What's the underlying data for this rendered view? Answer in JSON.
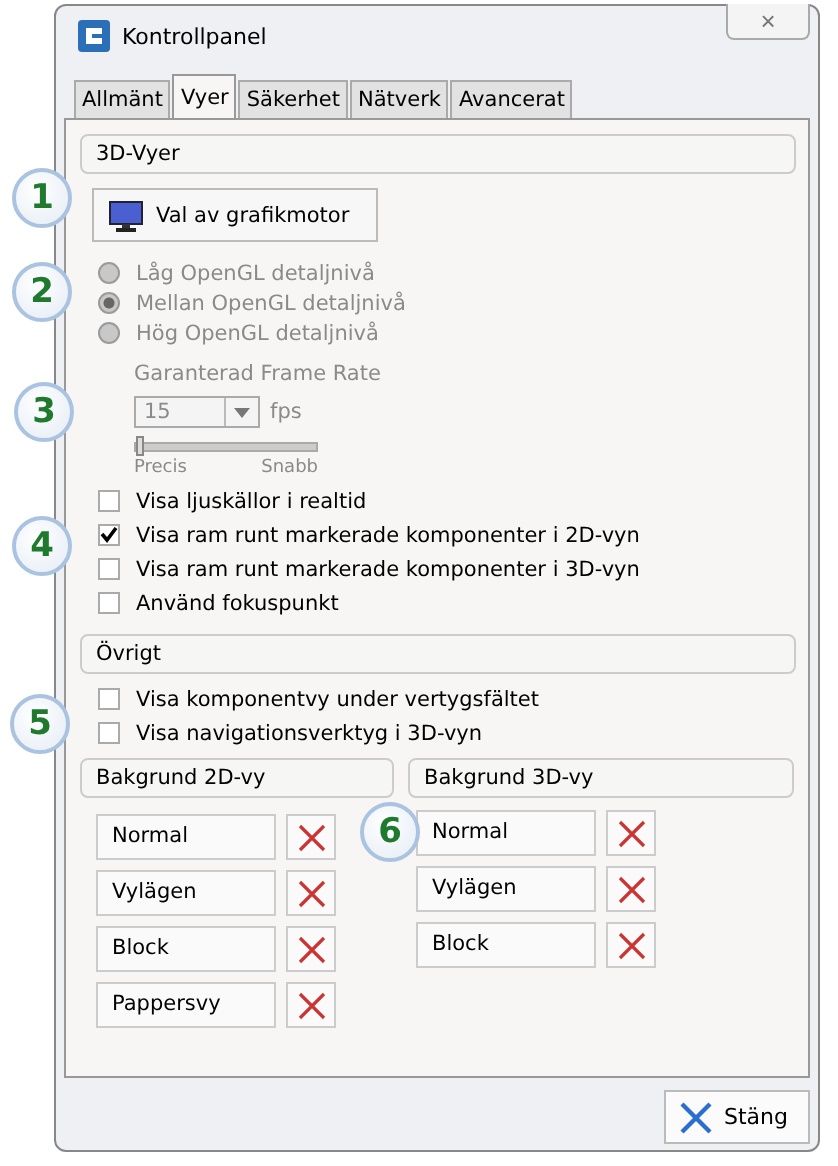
{
  "window": {
    "title": "Kontrollpanel",
    "close": "×"
  },
  "tabs": [
    {
      "label": "Allmänt",
      "selected": false
    },
    {
      "label": "Vyer",
      "selected": true
    },
    {
      "label": "Säkerhet",
      "selected": false
    },
    {
      "label": "Nätverk",
      "selected": false
    },
    {
      "label": "Avancerat",
      "selected": false
    }
  ],
  "views_3d": {
    "header": "3D-Vyer",
    "engine_button": "Val av grafikmotor",
    "detail_levels": {
      "disabled": true,
      "options": [
        {
          "label": "Låg OpenGL detaljnivå",
          "selected": false
        },
        {
          "label": "Mellan OpenGL detaljnivå",
          "selected": true
        },
        {
          "label": "Hög OpenGL detaljnivå",
          "selected": false
        }
      ]
    },
    "frame_rate": {
      "disabled": true,
      "label": "Garanterad Frame Rate",
      "value": "15",
      "unit": "fps",
      "slider": {
        "level": 0,
        "min_label": "Precis",
        "max_label": "Snabb"
      }
    },
    "options": [
      {
        "label": "Visa ljuskällor i realtid",
        "checked": false
      },
      {
        "label": "Visa ram runt markerade komponenter i 2D-vyn",
        "checked": true
      },
      {
        "label": "Visa ram runt markerade komponenter i 3D-vyn",
        "checked": false
      },
      {
        "label": "Använd fokuspunkt",
        "checked": false
      }
    ]
  },
  "other": {
    "header": "Övrigt",
    "options": [
      {
        "label": "Visa komponentvy under vertygsfältet",
        "checked": false
      },
      {
        "label": "Visa navigationsverktyg i 3D-vyn",
        "checked": false
      }
    ]
  },
  "backgrounds": [
    {
      "header": "Bakgrund 2D-vy",
      "items": [
        "Normal",
        "Vylägen",
        "Block",
        "Pappersvy"
      ]
    },
    {
      "header": "Bakgrund 3D-vy",
      "items": [
        "Normal",
        "Vylägen",
        "Block"
      ]
    }
  ],
  "close_button": "Stäng",
  "callouts": [
    "1",
    "2",
    "3",
    "4",
    "5",
    "6"
  ]
}
